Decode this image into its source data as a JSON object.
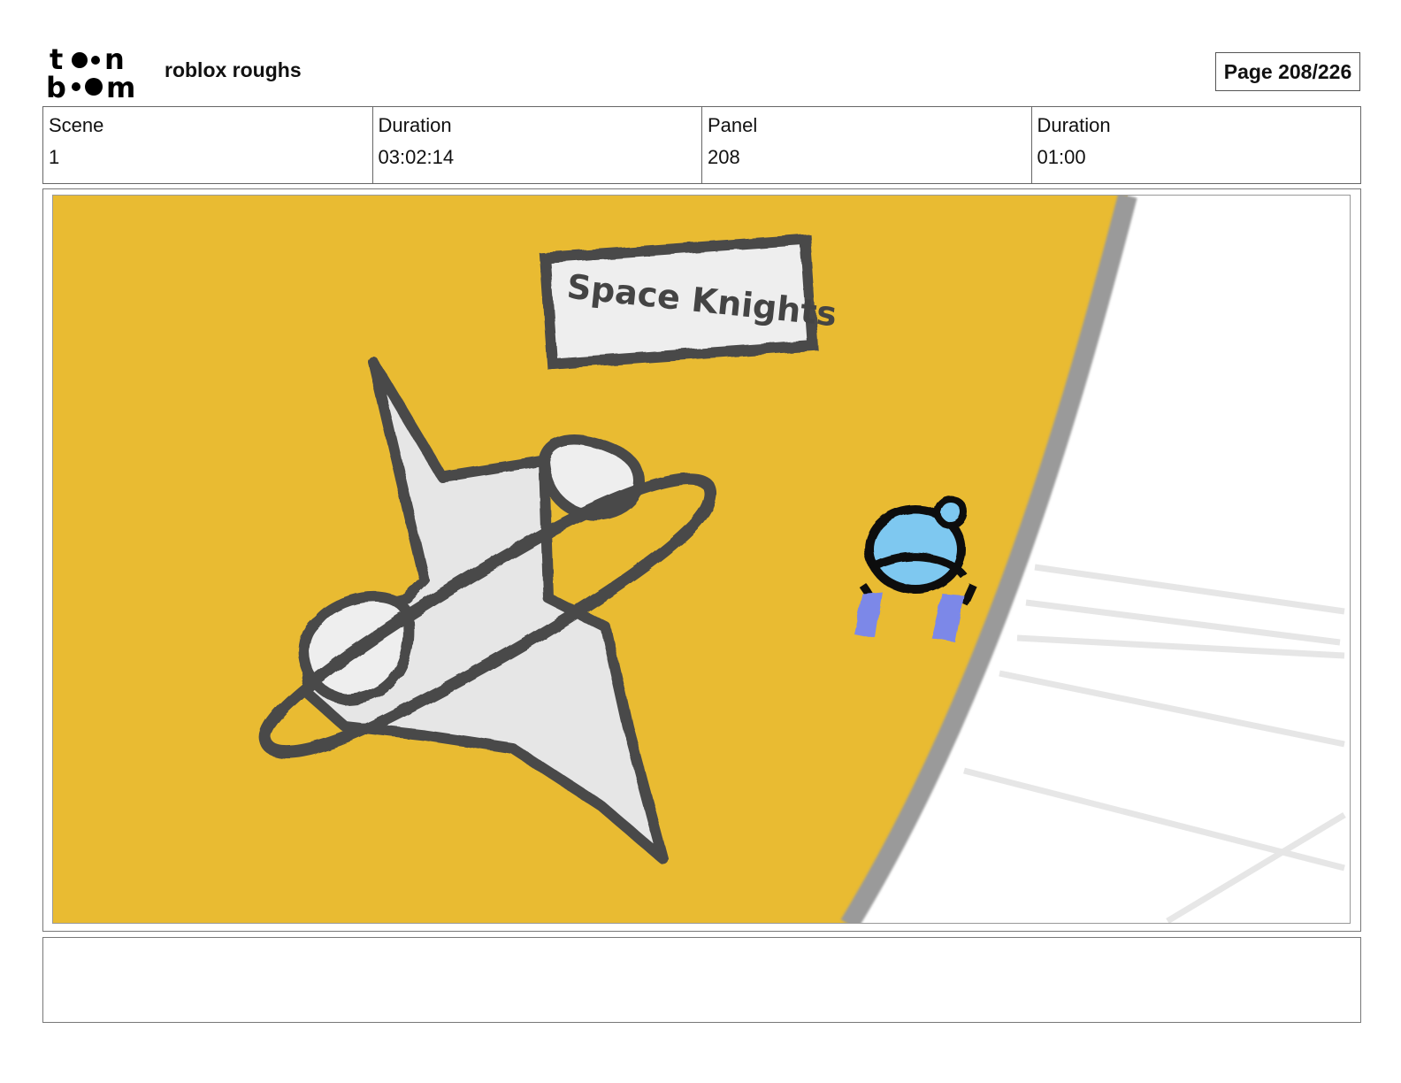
{
  "header": {
    "logo_text": "toon boom",
    "project_title": "roblox roughs",
    "page_label": "Page 208/226"
  },
  "info": {
    "scene_label": "Scene",
    "scene_value": "1",
    "scene_duration_label": "Duration",
    "scene_duration_value": "03:02:14",
    "panel_label": "Panel",
    "panel_value": "208",
    "panel_duration_label": "Duration",
    "panel_duration_value": "01:00"
  },
  "panel": {
    "sign_text": "Space Knights",
    "colors": {
      "planet": "#E9BB32",
      "outline": "#4A4A4A",
      "rim": "#9A9A9A",
      "knight": "#7EC8F0",
      "jets": "#7B88E8"
    }
  },
  "notes": {
    "text": ""
  }
}
